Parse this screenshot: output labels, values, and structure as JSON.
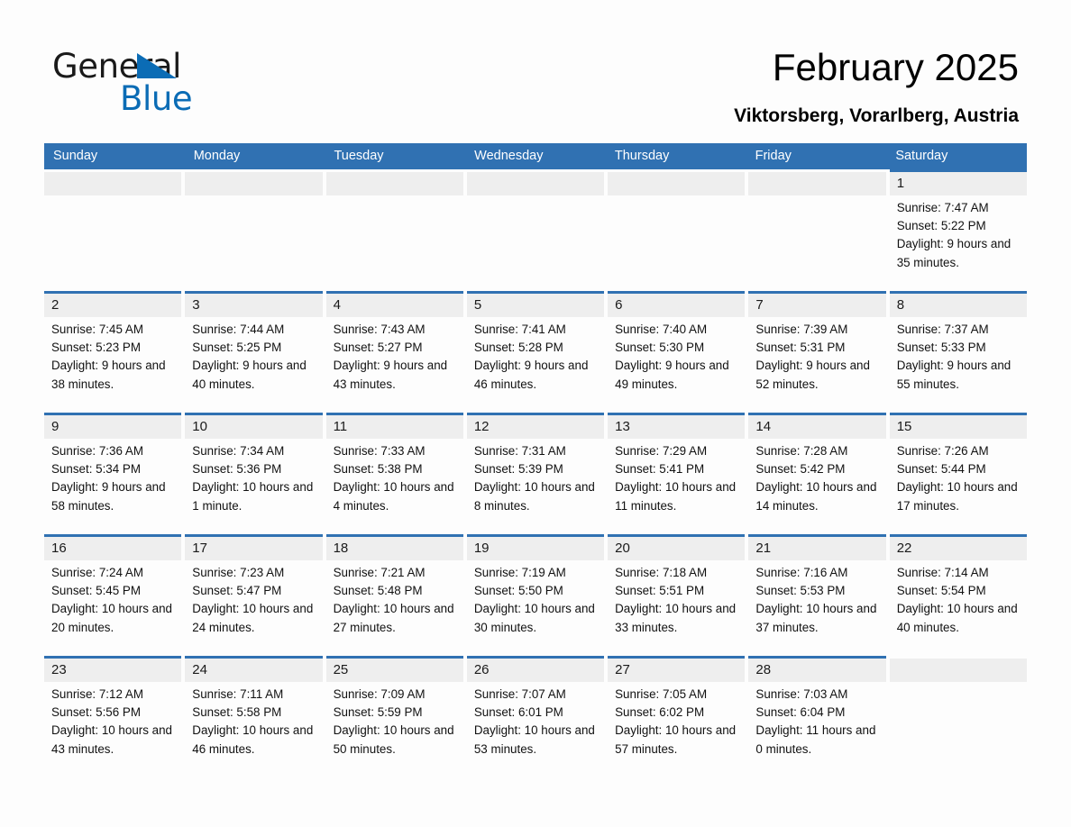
{
  "brand": {
    "name_part1": "General",
    "name_part2": "Blue",
    "triangle_color": "#0b6cb5"
  },
  "header": {
    "title": "February 2025",
    "subtitle": "Viktorsberg, Vorarlberg, Austria"
  },
  "theme": {
    "header_blue": "#3071b2",
    "daynum_bg": "#eeeeee",
    "page_bg": "#fdfdfd"
  },
  "day_headers": [
    "Sunday",
    "Monday",
    "Tuesday",
    "Wednesday",
    "Thursday",
    "Friday",
    "Saturday"
  ],
  "weeks": [
    [
      {
        "day": "",
        "blank": true
      },
      {
        "day": "",
        "blank": true
      },
      {
        "day": "",
        "blank": true
      },
      {
        "day": "",
        "blank": true
      },
      {
        "day": "",
        "blank": true
      },
      {
        "day": "",
        "blank": true
      },
      {
        "day": "1",
        "sunrise": "Sunrise: 7:47 AM",
        "sunset": "Sunset: 5:22 PM",
        "daylight": "Daylight: 9 hours and 35 minutes."
      }
    ],
    [
      {
        "day": "2",
        "sunrise": "Sunrise: 7:45 AM",
        "sunset": "Sunset: 5:23 PM",
        "daylight": "Daylight: 9 hours and 38 minutes."
      },
      {
        "day": "3",
        "sunrise": "Sunrise: 7:44 AM",
        "sunset": "Sunset: 5:25 PM",
        "daylight": "Daylight: 9 hours and 40 minutes."
      },
      {
        "day": "4",
        "sunrise": "Sunrise: 7:43 AM",
        "sunset": "Sunset: 5:27 PM",
        "daylight": "Daylight: 9 hours and 43 minutes."
      },
      {
        "day": "5",
        "sunrise": "Sunrise: 7:41 AM",
        "sunset": "Sunset: 5:28 PM",
        "daylight": "Daylight: 9 hours and 46 minutes."
      },
      {
        "day": "6",
        "sunrise": "Sunrise: 7:40 AM",
        "sunset": "Sunset: 5:30 PM",
        "daylight": "Daylight: 9 hours and 49 minutes."
      },
      {
        "day": "7",
        "sunrise": "Sunrise: 7:39 AM",
        "sunset": "Sunset: 5:31 PM",
        "daylight": "Daylight: 9 hours and 52 minutes."
      },
      {
        "day": "8",
        "sunrise": "Sunrise: 7:37 AM",
        "sunset": "Sunset: 5:33 PM",
        "daylight": "Daylight: 9 hours and 55 minutes."
      }
    ],
    [
      {
        "day": "9",
        "sunrise": "Sunrise: 7:36 AM",
        "sunset": "Sunset: 5:34 PM",
        "daylight": "Daylight: 9 hours and 58 minutes."
      },
      {
        "day": "10",
        "sunrise": "Sunrise: 7:34 AM",
        "sunset": "Sunset: 5:36 PM",
        "daylight": "Daylight: 10 hours and 1 minute."
      },
      {
        "day": "11",
        "sunrise": "Sunrise: 7:33 AM",
        "sunset": "Sunset: 5:38 PM",
        "daylight": "Daylight: 10 hours and 4 minutes."
      },
      {
        "day": "12",
        "sunrise": "Sunrise: 7:31 AM",
        "sunset": "Sunset: 5:39 PM",
        "daylight": "Daylight: 10 hours and 8 minutes."
      },
      {
        "day": "13",
        "sunrise": "Sunrise: 7:29 AM",
        "sunset": "Sunset: 5:41 PM",
        "daylight": "Daylight: 10 hours and 11 minutes."
      },
      {
        "day": "14",
        "sunrise": "Sunrise: 7:28 AM",
        "sunset": "Sunset: 5:42 PM",
        "daylight": "Daylight: 10 hours and 14 minutes."
      },
      {
        "day": "15",
        "sunrise": "Sunrise: 7:26 AM",
        "sunset": "Sunset: 5:44 PM",
        "daylight": "Daylight: 10 hours and 17 minutes."
      }
    ],
    [
      {
        "day": "16",
        "sunrise": "Sunrise: 7:24 AM",
        "sunset": "Sunset: 5:45 PM",
        "daylight": "Daylight: 10 hours and 20 minutes."
      },
      {
        "day": "17",
        "sunrise": "Sunrise: 7:23 AM",
        "sunset": "Sunset: 5:47 PM",
        "daylight": "Daylight: 10 hours and 24 minutes."
      },
      {
        "day": "18",
        "sunrise": "Sunrise: 7:21 AM",
        "sunset": "Sunset: 5:48 PM",
        "daylight": "Daylight: 10 hours and 27 minutes."
      },
      {
        "day": "19",
        "sunrise": "Sunrise: 7:19 AM",
        "sunset": "Sunset: 5:50 PM",
        "daylight": "Daylight: 10 hours and 30 minutes."
      },
      {
        "day": "20",
        "sunrise": "Sunrise: 7:18 AM",
        "sunset": "Sunset: 5:51 PM",
        "daylight": "Daylight: 10 hours and 33 minutes."
      },
      {
        "day": "21",
        "sunrise": "Sunrise: 7:16 AM",
        "sunset": "Sunset: 5:53 PM",
        "daylight": "Daylight: 10 hours and 37 minutes."
      },
      {
        "day": "22",
        "sunrise": "Sunrise: 7:14 AM",
        "sunset": "Sunset: 5:54 PM",
        "daylight": "Daylight: 10 hours and 40 minutes."
      }
    ],
    [
      {
        "day": "23",
        "sunrise": "Sunrise: 7:12 AM",
        "sunset": "Sunset: 5:56 PM",
        "daylight": "Daylight: 10 hours and 43 minutes."
      },
      {
        "day": "24",
        "sunrise": "Sunrise: 7:11 AM",
        "sunset": "Sunset: 5:58 PM",
        "daylight": "Daylight: 10 hours and 46 minutes."
      },
      {
        "day": "25",
        "sunrise": "Sunrise: 7:09 AM",
        "sunset": "Sunset: 5:59 PM",
        "daylight": "Daylight: 10 hours and 50 minutes."
      },
      {
        "day": "26",
        "sunrise": "Sunrise: 7:07 AM",
        "sunset": "Sunset: 6:01 PM",
        "daylight": "Daylight: 10 hours and 53 minutes."
      },
      {
        "day": "27",
        "sunrise": "Sunrise: 7:05 AM",
        "sunset": "Sunset: 6:02 PM",
        "daylight": "Daylight: 10 hours and 57 minutes."
      },
      {
        "day": "28",
        "sunrise": "Sunrise: 7:03 AM",
        "sunset": "Sunset: 6:04 PM",
        "daylight": "Daylight: 11 hours and 0 minutes."
      },
      {
        "day": "",
        "blank": true
      }
    ]
  ]
}
